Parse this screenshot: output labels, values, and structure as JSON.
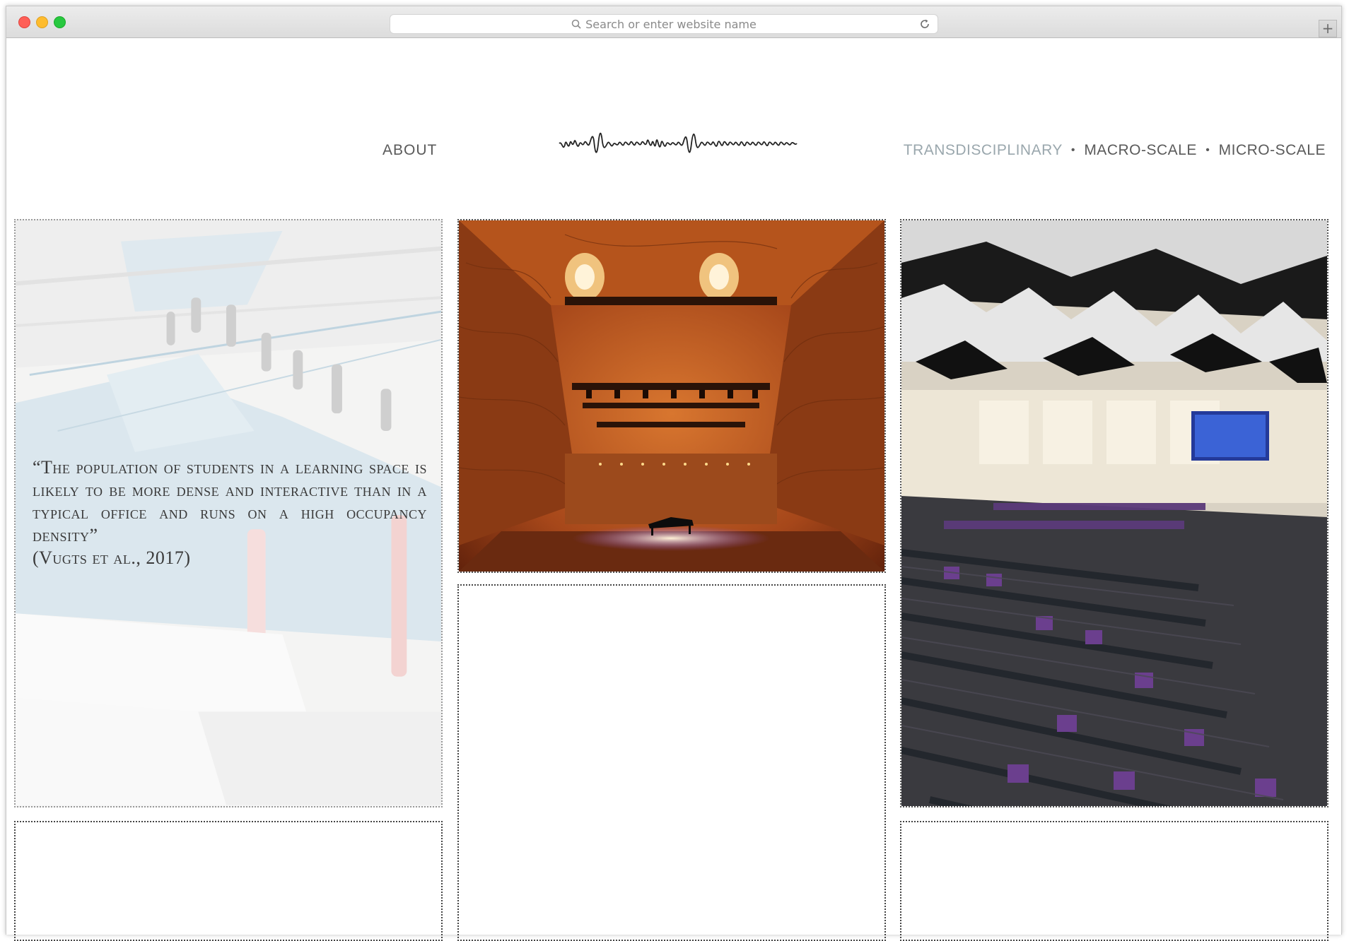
{
  "browser": {
    "address_placeholder": "Search or enter website name",
    "new_tab_label": "+"
  },
  "nav": {
    "about": "ABOUT",
    "categories": [
      "TRANSDISCIPLINARY",
      "MACRO-SCALE",
      "MICRO-SCALE"
    ],
    "separator": "•",
    "active_category": "TRANSDISCIPLINARY"
  },
  "colors": {
    "nav_text": "#5a5a5a",
    "nav_active": "#9aa7ad",
    "concert_wood": "#b5541c",
    "auditorium_seat": "#5b3a7a"
  },
  "tiles": {
    "learning_space": {
      "quote": "“The population of students in a learning space is likely to be more dense and interactive than in a typical office and runs on a high occupancy density”",
      "citation": "(Vugts et al., 2017)"
    }
  }
}
